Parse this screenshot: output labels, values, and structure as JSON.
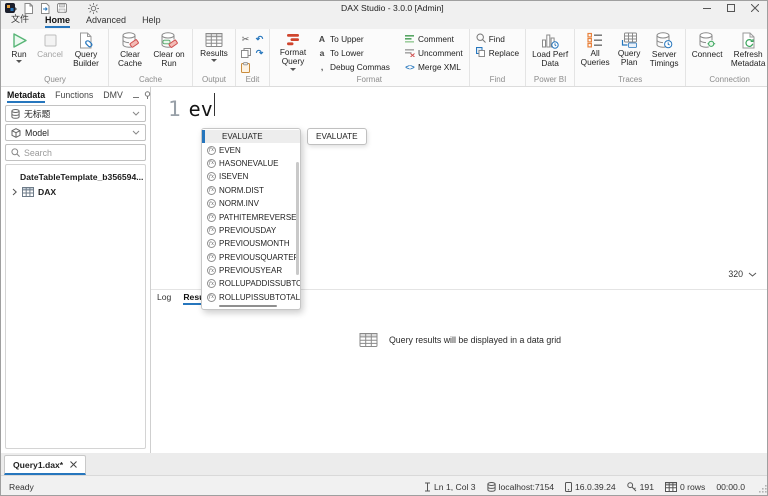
{
  "window": {
    "title": "DAX Studio - 3.0.0 [Admin]"
  },
  "menu": {
    "file": "文件",
    "home": "Home",
    "advanced": "Advanced",
    "help": "Help"
  },
  "ribbon": {
    "query": {
      "label": "Query",
      "run": "Run",
      "cancel": "Cancel",
      "query_builder": "Query Builder"
    },
    "cache": {
      "label": "Cache",
      "clear_cache": "Clear Cache",
      "clear_on_run": "Clear on Run"
    },
    "output": {
      "label": "Output",
      "results": "Results"
    },
    "edit": {
      "label": "Edit"
    },
    "format": {
      "label": "Format",
      "format_query": "Format Query",
      "to_upper": "To Upper",
      "to_lower": "To Lower",
      "debug_commas": "Debug Commas",
      "comment": "Comment",
      "uncomment": "Uncomment",
      "merge_xml": "Merge XML"
    },
    "find": {
      "label": "Find",
      "find": "Find",
      "replace": "Replace"
    },
    "power_bi": {
      "label": "Power BI",
      "load_perf_data": "Load Perf Data"
    },
    "traces": {
      "label": "Traces",
      "all_queries": "All Queries",
      "query_plan": "Query Plan",
      "server_timings": "Server Timings"
    },
    "connection": {
      "label": "Connection",
      "connect": "Connect",
      "refresh_metadata": "Refresh Metadata"
    }
  },
  "sidebar": {
    "tabs": {
      "metadata": "Metadata",
      "functions": "Functions",
      "dmv": "DMV"
    },
    "database": "无标题",
    "model": "Model",
    "search_placeholder": "Search",
    "tree": [
      {
        "label": "DateTableTemplate_b356594..."
      },
      {
        "label": "DAX"
      }
    ]
  },
  "editor": {
    "line_number": "1",
    "code": "ev",
    "tooltip": "EVALUATE",
    "width_indicator": "320",
    "autocomplete": {
      "selected": "EVALUATE",
      "items": [
        "EVEN",
        "HASONEVALUE",
        "ISEVEN",
        "NORM.DIST",
        "NORM.INV",
        "PATHITEMREVERSE",
        "PREVIOUSDAY",
        "PREVIOUSMONTH",
        "PREVIOUSQUARTER",
        "PREVIOUSYEAR",
        "ROLLUPADDISSUBTOTAL",
        "ROLLUPISSUBTOTAL"
      ]
    }
  },
  "results_panel": {
    "log_tab": "Log",
    "results_tab": "Results",
    "empty_message": "Query results will be displayed in a data grid"
  },
  "document_tabs": [
    {
      "label": "Query1.dax*"
    }
  ],
  "statusbar": {
    "status": "Ready",
    "position": "Ln 1, Col 3",
    "server": "localhost:7154",
    "version": "16.0.39.24",
    "spid": "191",
    "rows": "0 rows",
    "timer": "00:00.0"
  },
  "icons": {
    "function_glyph": "fx",
    "cut": "✂",
    "undo": "↶",
    "redo": "↷",
    "to_upper": "A",
    "to_lower": "a",
    "debug_comma": ",",
    "merge_xml": "<>"
  },
  "colors": {
    "accent": "#2676bd",
    "run_green": "#53a96d",
    "format_red": "#d0452e",
    "orange": "#e8823d"
  }
}
